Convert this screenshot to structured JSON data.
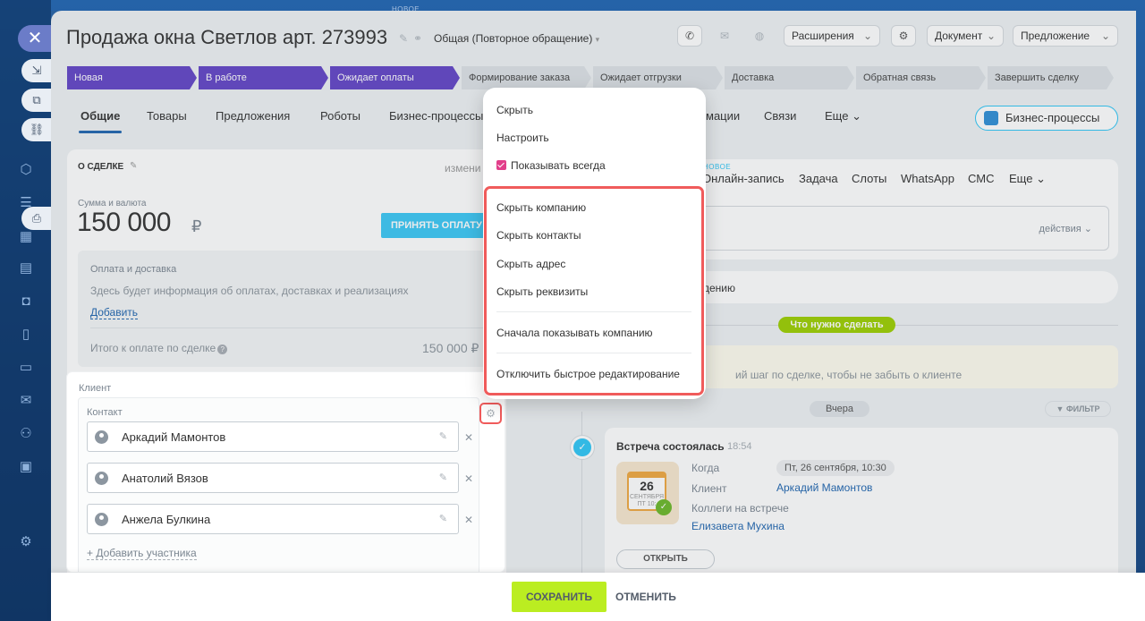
{
  "top_label": "НОВОЕ",
  "deal": {
    "title": "Продажа окна Светлов арт. 273993",
    "category": "Общая (Повторное обращение)"
  },
  "toolbar": {
    "extensions": "Расширения",
    "document": "Документ",
    "offer": "Предложение"
  },
  "stages": [
    {
      "label": "Новая",
      "state": "active",
      "bar_color": ""
    },
    {
      "label": "В работе",
      "state": "active",
      "bar_color": ""
    },
    {
      "label": "Ожидает оплаты",
      "state": "active",
      "bar_color": ""
    },
    {
      "label": "Формирование заказа",
      "state": "pending",
      "bar_color": "#2fc6f6"
    },
    {
      "label": "Ожидает отгрузки",
      "state": "pending",
      "bar_color": "#2066b0"
    },
    {
      "label": "Доставка",
      "state": "pending",
      "bar_color": "#9b59d0"
    },
    {
      "label": "Обратная связь",
      "state": "pending",
      "bar_color": "#f0a840"
    },
    {
      "label": "Завершить сделку",
      "state": "pending",
      "bar_color": "#9dcf00"
    }
  ],
  "tabs": [
    {
      "label": "Общие",
      "active": true
    },
    {
      "label": "Товары"
    },
    {
      "label": "Предложения"
    },
    {
      "label": "Роботы"
    },
    {
      "label": "Бизнес-процессы"
    },
    {
      "label": "мации"
    },
    {
      "label": "Связи"
    },
    {
      "label": "Еще"
    }
  ],
  "bp_button": "Бизнес-процессы",
  "deal_card": {
    "header": "О СДЕЛКЕ",
    "edit": "измени",
    "sum_label": "Сумма и валюта",
    "sum_value": "150 000",
    "currency": "₽",
    "accept_button": "ПРИНЯТЬ ОПЛАТУ",
    "payment_title": "Оплата и доставка",
    "payment_info": "Здесь будет информация об оплатах, доставках и реализациях",
    "payment_add": "Добавить",
    "total_label": "Итого к оплате по сделке",
    "total_value": "150 000 ₽"
  },
  "client": {
    "label": "Клиент",
    "contact_label": "Контакт",
    "contacts": [
      "Аркадий Мамонтов",
      "Анатолий Вязов",
      "Анжела Булкина"
    ],
    "add_participant": "+ Добавить участника"
  },
  "menu": {
    "items_top": [
      "Скрыть",
      "Настроить"
    ],
    "show_always": "Показывать всегда",
    "items_highlight": [
      "Скрыть компанию",
      "Скрыть контакты",
      "Скрыть адрес",
      "Скрыть реквизиты"
    ],
    "show_company_first": "Сначала показывать компанию",
    "disable_quick_edit": "Отключить быстрое редактирование"
  },
  "timeline": {
    "novo": "НОВОЕ",
    "tabs": [
      "Онлайн-запись",
      "Задача",
      "Слоты",
      "WhatsApp",
      "СМС",
      "Еще"
    ],
    "actions": "действия",
    "bar_text": "дению",
    "todo": "Что нужно сделать",
    "yellow_text": "ий шаг по сделке, чтобы не забыть о клиенте",
    "yesterday": "Вчера",
    "filter": "ФИЛЬТР"
  },
  "event": {
    "title": "Встреча состоялась",
    "time": "18:54",
    "cal_day": "26",
    "cal_month": "СЕНТЯБРЯ",
    "cal_weekday": "ПТ 10:",
    "when_label": "Когда",
    "when_value": "Пт, 26 сентября, 10:30",
    "client_label": "Клиент",
    "client_value": "Аркадий Мамонтов",
    "colleagues_label": "Коллеги на встрече",
    "colleague": "Елизавета Мухина",
    "open_button": "ОТКРЫТЬ"
  },
  "footer": {
    "save": "СОХРАНИТЬ",
    "cancel": "ОТМЕНИТЬ"
  }
}
